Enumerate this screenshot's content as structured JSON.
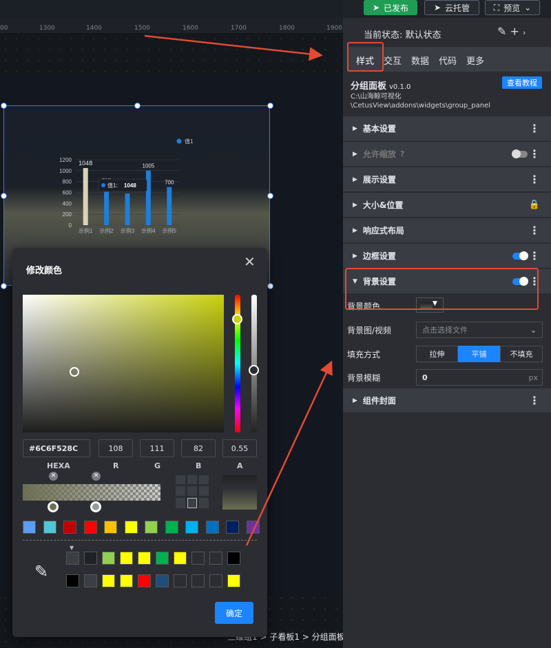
{
  "topbar": {
    "published_label": "已发布",
    "cloud_label": "云托管",
    "preview_label": "预览"
  },
  "ruler": {
    "ticks": [
      "00",
      "1300",
      "1400",
      "1500",
      "1600",
      "1700",
      "1800",
      "1900"
    ]
  },
  "chart_data": {
    "type": "bar",
    "categories": [
      "示例1",
      "示例2",
      "示例3",
      "示例4",
      "示例5"
    ],
    "series": [
      {
        "name": "值1",
        "values": [
          1048,
          735,
          580,
          1005,
          700
        ]
      }
    ],
    "data_labels": [
      "1048",
      "735",
      "",
      "1005",
      "700"
    ],
    "yticks": [
      "1200",
      "1000",
      "800",
      "600",
      "400",
      "200",
      "0"
    ],
    "ylim": [
      0,
      1200
    ],
    "legend": "top-right",
    "tooltip": {
      "label": "值1:",
      "value": "1048"
    }
  },
  "dialog": {
    "title": "修改颜色",
    "hexa": "#6C6F528C",
    "r": "108",
    "g": "111",
    "b": "82",
    "a": "0.55",
    "labels": {
      "hexa": "HEXA",
      "r": "R",
      "g": "G",
      "b": "B",
      "a": "A"
    },
    "ok_label": "确定",
    "preset_colors": [
      "#5b9cf5",
      "#4fc7d8",
      "#c00000",
      "#ff0000",
      "#ffc000",
      "#ffff00",
      "#92d050",
      "#00b050",
      "#00b0f0",
      "#0070c0",
      "#002060",
      "#7030a0"
    ],
    "history_row1": [
      "#3b3e45",
      "#1e2226",
      "#92d050",
      "#ffff00",
      "#ffff00",
      "#00b050",
      "#ffff00",
      "#2b2d32",
      "#2b2d32",
      "#000000"
    ],
    "history_row2": [
      "#000000",
      "#3b3e45",
      "#ffff00",
      "#ffff00",
      "#ff0000",
      "#1f4e79",
      "#2b2d32",
      "#2b2d32",
      "#2b2d32",
      "#ffff00"
    ]
  },
  "breadcrumb": "三维组1 > 子看板1 > 分组面板",
  "panel": {
    "state_label": "当前状态:",
    "state_value": "默认状态",
    "tabs": [
      "样式",
      "交互",
      "数据",
      "代码",
      "更多"
    ],
    "widget_name": "分组面板",
    "widget_version": "v0.1.0",
    "widget_path_1": "C:\\山海鲸可视化",
    "widget_path_2": "\\CetusView\\addons\\widgets\\group_panel",
    "help_label": "查看教程",
    "sections": [
      "基本设置",
      "允许缩放",
      "展示设置",
      "大小&位置",
      "响应式布局",
      "边框设置",
      "背景设置",
      "组件封面"
    ],
    "bg": {
      "color_label": "背景颜色",
      "image_label": "背景图/视频",
      "image_placeholder": "点击选择文件",
      "fill_label": "填充方式",
      "fill_options": [
        "拉伸",
        "平铺",
        "不填充"
      ],
      "blur_label": "背景模糊",
      "blur_value": "0",
      "blur_unit": "px"
    }
  }
}
